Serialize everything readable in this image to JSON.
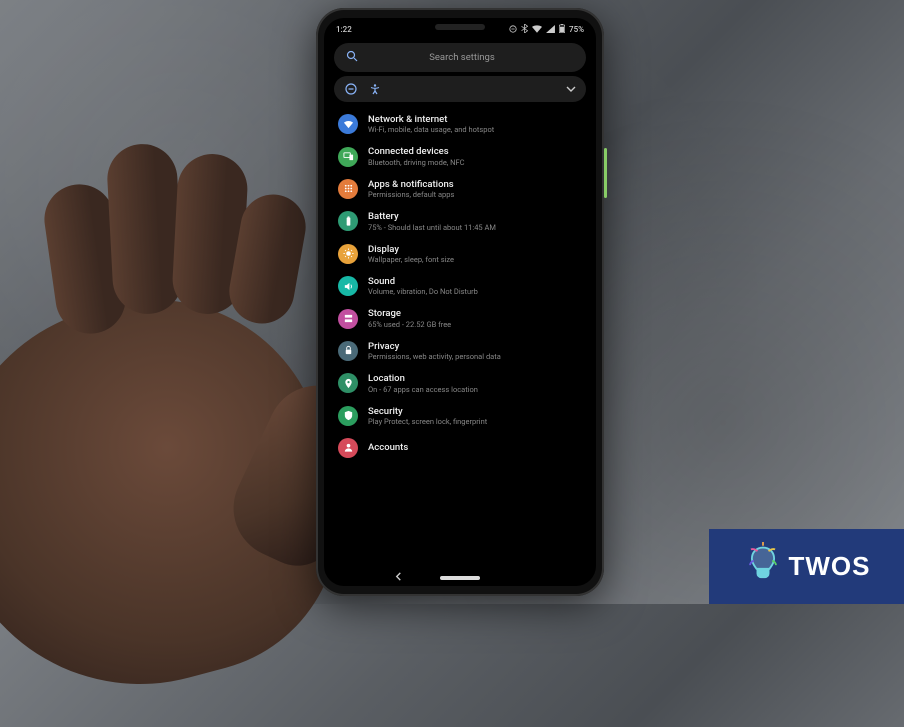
{
  "status_bar": {
    "time": "1:22",
    "battery_text": "75%"
  },
  "search": {
    "placeholder": "Search settings"
  },
  "settings": [
    {
      "id": "network",
      "title": "Network & internet",
      "subtitle": "Wi-Fi, mobile, data usage, and hotspot",
      "color": "#3b7ad9"
    },
    {
      "id": "devices",
      "title": "Connected devices",
      "subtitle": "Bluetooth, driving mode, NFC",
      "color": "#3fa858"
    },
    {
      "id": "apps",
      "title": "Apps & notifications",
      "subtitle": "Permissions, default apps",
      "color": "#e37b3b"
    },
    {
      "id": "battery",
      "title": "Battery",
      "subtitle": "75% - Should last until about 11:45 AM",
      "color": "#2e9b74"
    },
    {
      "id": "display",
      "title": "Display",
      "subtitle": "Wallpaper, sleep, font size",
      "color": "#e8a23a"
    },
    {
      "id": "sound",
      "title": "Sound",
      "subtitle": "Volume, vibration, Do Not Disturb",
      "color": "#17b8a6"
    },
    {
      "id": "storage",
      "title": "Storage",
      "subtitle": "65% used - 22.52 GB free",
      "color": "#c24fa0"
    },
    {
      "id": "privacy",
      "title": "Privacy",
      "subtitle": "Permissions, web activity, personal data",
      "color": "#4a6a78"
    },
    {
      "id": "location",
      "title": "Location",
      "subtitle": "On - 67 apps can access location",
      "color": "#2e8f66"
    },
    {
      "id": "security",
      "title": "Security",
      "subtitle": "Play Protect, screen lock, fingerprint",
      "color": "#2b9d5e"
    },
    {
      "id": "accounts",
      "title": "Accounts",
      "subtitle": "",
      "color": "#d64a5a"
    }
  ],
  "logo": {
    "text": "TWOS"
  }
}
